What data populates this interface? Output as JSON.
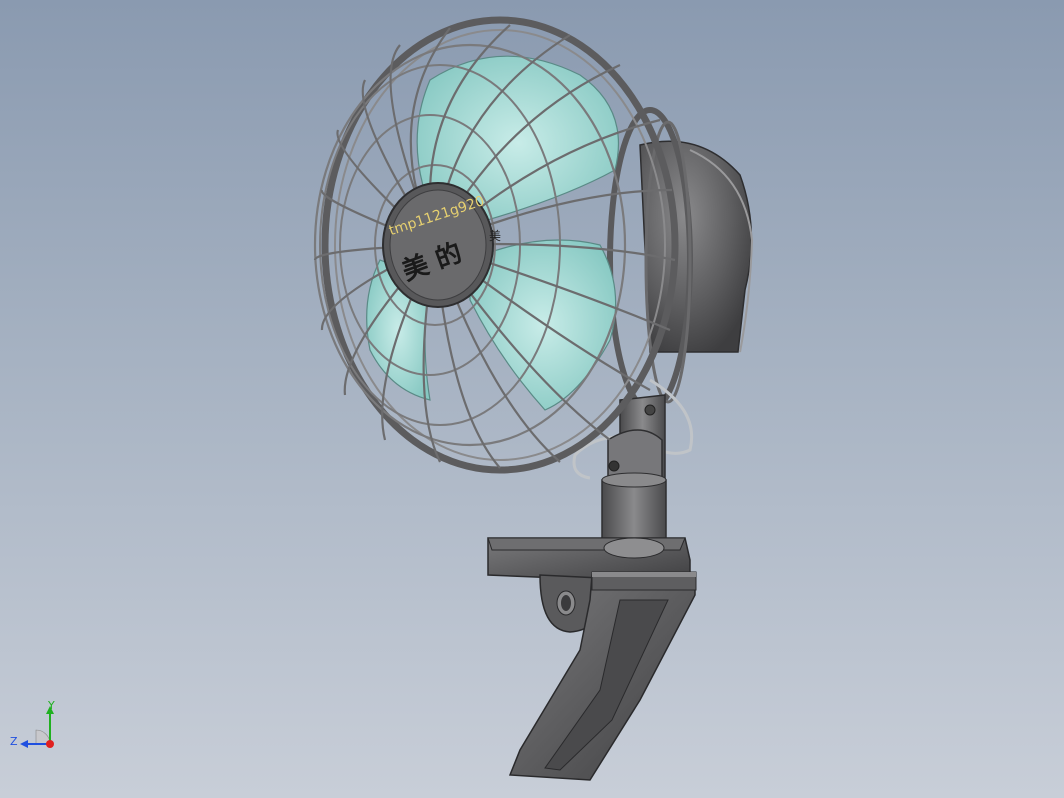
{
  "viewport": {
    "background_top": "#8a9ab0",
    "background_bottom": "#c8ced8"
  },
  "model": {
    "hub_text_ring": "tmp1121g920",
    "hub_text_main": "美 的",
    "hub_text_side": "美",
    "colors": {
      "blade": "#9fd6d0",
      "guard": "#6f6f72",
      "body": "#5e5e60",
      "hub": "#5a5a5c"
    }
  },
  "triad": {
    "y_label": "Y",
    "z_label": "Z",
    "x_color": "#e02020",
    "y_color": "#20b020",
    "z_color": "#2050e0"
  }
}
